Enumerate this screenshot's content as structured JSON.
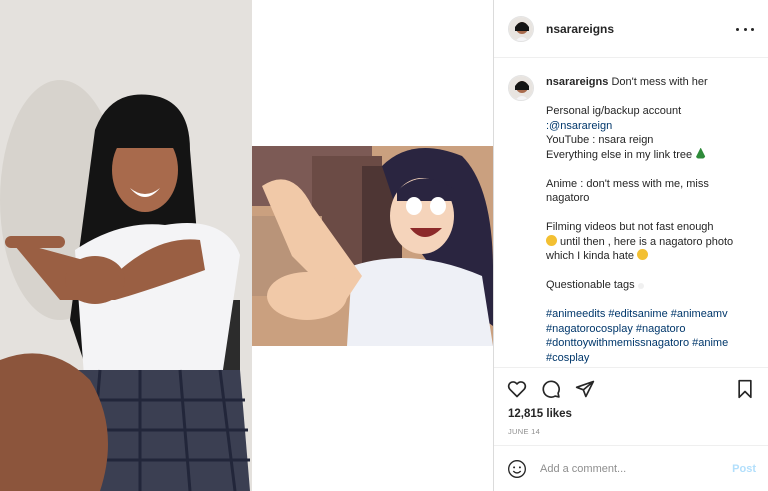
{
  "post": {
    "username": "nsarareigns",
    "more_icon": "more-horizontal-icon"
  },
  "media": {
    "left_image": "photo-cosplay",
    "right_image": "photo-anime"
  },
  "caption": {
    "username": "nsarareigns",
    "title": "Don't mess with her",
    "line1": "Personal ig/backup account",
    "line2": ":@nsarareign",
    "line3": "YouTube : nsara reign",
    "line4": "Everything else in my link tree",
    "line5": "Anime : don't mess with me, miss nagatoro",
    "line6": "Filming videos but not fast enough",
    "line7": " until then , here is a nagatoro photo which I kinda hate",
    "line8": "Questionable tags",
    "hashtags": "#animeedits #editsanime #animeamv #nagatorocosplay #nagatoro #donttoywithmemissnagatoro #anime #cosplay"
  },
  "actions": {
    "like_icon": "heart-icon",
    "comment_icon": "comment-icon",
    "share_icon": "share-icon",
    "save_icon": "bookmark-icon"
  },
  "stats": {
    "likes": "12,815 likes",
    "date": "JUNE 14"
  },
  "comment": {
    "placeholder": "Add a comment...",
    "post_label": "Post"
  },
  "colors": {
    "link": "#00376b",
    "post_button": "#b2dffc",
    "border": "#efefef",
    "muted": "#8e8e8e"
  }
}
